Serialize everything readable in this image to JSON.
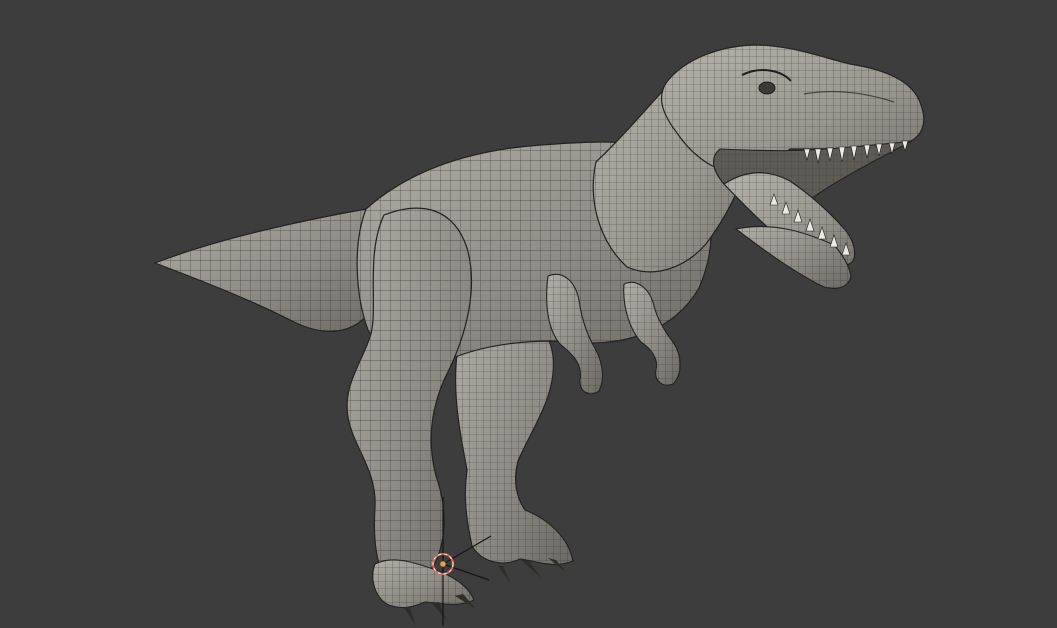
{
  "viewport": {
    "background": "#3d3d3d",
    "mode": "wireframe",
    "object": "trex-mesh"
  },
  "mesh": {
    "fill": "#8f8c85",
    "highlight": "#b3b0a8",
    "shadow": "#64625d",
    "wire": "#2a2a28"
  },
  "gizmo": {
    "cursor_color": "#d86a56",
    "cursor_ring": "#f2e6df"
  }
}
